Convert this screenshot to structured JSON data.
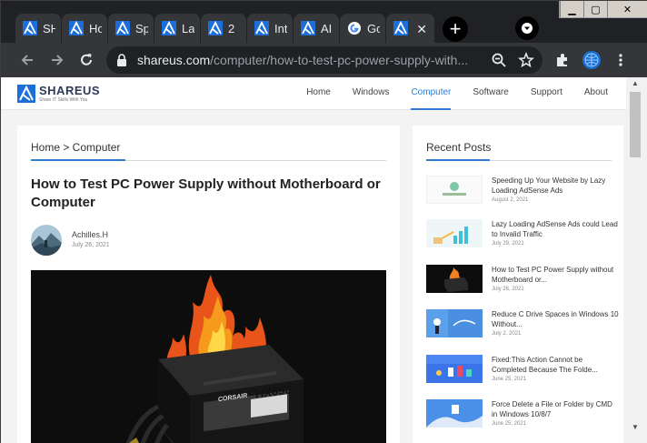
{
  "browser": {
    "tabs": [
      {
        "label": "SH",
        "favicon": "shareus-icon"
      },
      {
        "label": "Ho",
        "favicon": "shareus-icon"
      },
      {
        "label": "Sp",
        "favicon": "shareus-icon"
      },
      {
        "label": "La",
        "favicon": "shareus-icon"
      },
      {
        "label": "2",
        "favicon": "shareus-icon"
      },
      {
        "label": "Int",
        "favicon": "shareus-icon"
      },
      {
        "label": "AI",
        "favicon": "shareus-icon"
      },
      {
        "label": "Go",
        "favicon": "google-icon"
      },
      {
        "label": "",
        "favicon": "shareus-icon",
        "active": true
      }
    ],
    "new_tab": "+",
    "url_domain": "shareus.com",
    "url_path": "/computer/how-to-test-pc-power-supply-with...",
    "accent": "#2f7dd1"
  },
  "site": {
    "logo_name": "SHAREUS",
    "logo_tagline": "Share IT Skills With You",
    "nav": [
      "Home",
      "Windows",
      "Computer",
      "Software",
      "Support",
      "About"
    ],
    "active_nav": "Computer"
  },
  "article": {
    "breadcrumb": "Home > Computer",
    "title": "How to Test PC Power Supply without Motherboard or Computer",
    "author": "Achilles.H",
    "date": "July 26, 2021",
    "hero_label": "HX650",
    "hero_brand": "CORSAIR"
  },
  "sidebar": {
    "title": "Recent Posts",
    "posts": [
      {
        "title": "Speeding Up Your Website by Lazy Loading AdSense Ads",
        "date": "August 2, 2021"
      },
      {
        "title": "Lazy Loading AdSense Ads could Lead to Invalid Traffic",
        "date": "July 29, 2021"
      },
      {
        "title": "How to Test PC Power Supply without Motherboard or...",
        "date": "July 26, 2021"
      },
      {
        "title": "Reduce C Drive Spaces in Windows 10 Without...",
        "date": "July 2, 2021"
      },
      {
        "title": "Fixed:This Action Cannot be Completed Because The Folde...",
        "date": "June 25, 2021"
      },
      {
        "title": "Force Delete a File or Folder by CMD in Windows 10/8/7",
        "date": "June 25, 2021"
      }
    ]
  }
}
